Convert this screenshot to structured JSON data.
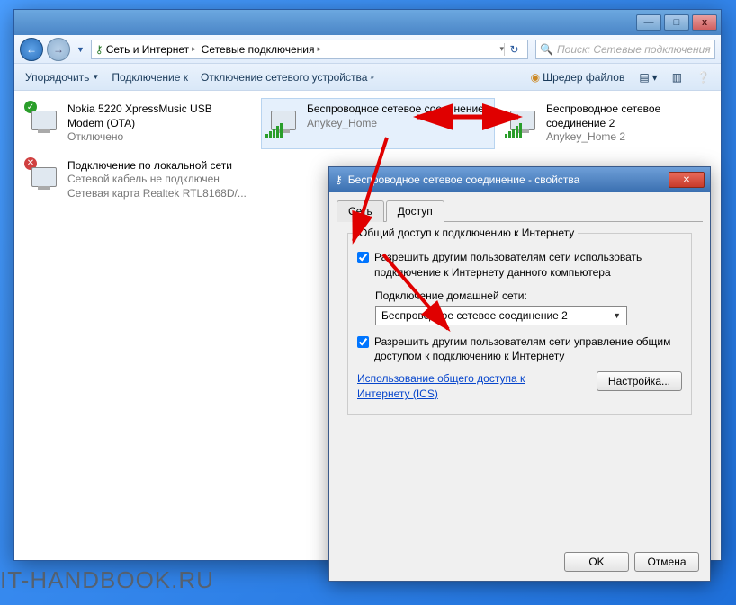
{
  "titlebar": {
    "minimize": "—",
    "maximize": "□",
    "close": "x"
  },
  "nav": {
    "breadcrumb": [
      "Сеть и Интернет",
      "Сетевые подключения"
    ],
    "search_placeholder": "Поиск: Сетевые подключения"
  },
  "toolbar": {
    "organize": "Упорядочить",
    "connect": "Подключение к",
    "disable": "Отключение сетевого устройства",
    "shredder": "Шредер файлов"
  },
  "connections": [
    {
      "title": "Nokia 5220 XpressMusic USB Modem (OTA)",
      "status": "Отключено",
      "type": "modem"
    },
    {
      "title": "Беспроводное сетевое соединение",
      "status": "Anykey_Home",
      "type": "wifi",
      "selected": true
    },
    {
      "title": "Беспроводное сетевое соединение 2",
      "status": "Anykey_Home 2",
      "type": "wifi"
    },
    {
      "title": "Подключение по локальной сети",
      "status": "Сетевой кабель не подключен",
      "adapter": "Сетевая карта Realtek RTL8168D/...",
      "type": "lan"
    }
  ],
  "dialog": {
    "title": "Беспроводное сетевое соединение - свойства",
    "tab_net": "Сеть",
    "tab_access": "Доступ",
    "group_title": "Общий доступ к подключению к Интернету",
    "chk1": "Разрешить другим пользователям сети использовать подключение к Интернету данного компьютера",
    "home_label": "Подключение домашней сети:",
    "combo_value": "Беспроводное сетевое соединение 2",
    "chk2": "Разрешить другим пользователям сети управление общим доступом к подключению к Интернету",
    "ics_link": "Использование общего доступа к Интернету (ICS)",
    "settings_btn": "Настройка...",
    "ok": "OK",
    "cancel": "Отмена"
  },
  "watermark": "IT-HANDBOOK.RU"
}
